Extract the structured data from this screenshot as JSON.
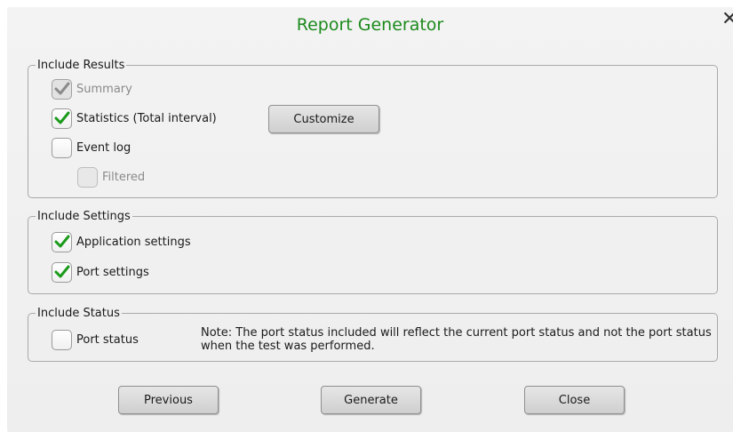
{
  "dialog": {
    "title": "Report Generator",
    "close_glyph": "✕"
  },
  "include_results": {
    "legend": "Include Results",
    "summary": {
      "label": "Summary",
      "checked": true,
      "enabled": false
    },
    "statistics": {
      "label": "Statistics (Total interval)",
      "checked": true,
      "enabled": true
    },
    "customize_label": "Customize",
    "event_log": {
      "label": "Event log",
      "checked": false,
      "enabled": true
    },
    "filtered": {
      "label": "Filtered",
      "checked": false,
      "enabled": false
    }
  },
  "include_settings": {
    "legend": "Include Settings",
    "application_settings": {
      "label": "Application settings",
      "checked": true
    },
    "port_settings": {
      "label": "Port settings",
      "checked": true
    }
  },
  "include_status": {
    "legend": "Include Status",
    "port_status": {
      "label": "Port status",
      "checked": false
    },
    "note": "Note:  The port status included will reflect the current port status and not the port status when the test was performed."
  },
  "footer": {
    "previous_label": "Previous",
    "generate_label": "Generate",
    "close_label": "Close"
  },
  "colors": {
    "title": "#1c8a1c",
    "check": "#1a9a1a",
    "check_disabled": "#8a8a8a"
  }
}
